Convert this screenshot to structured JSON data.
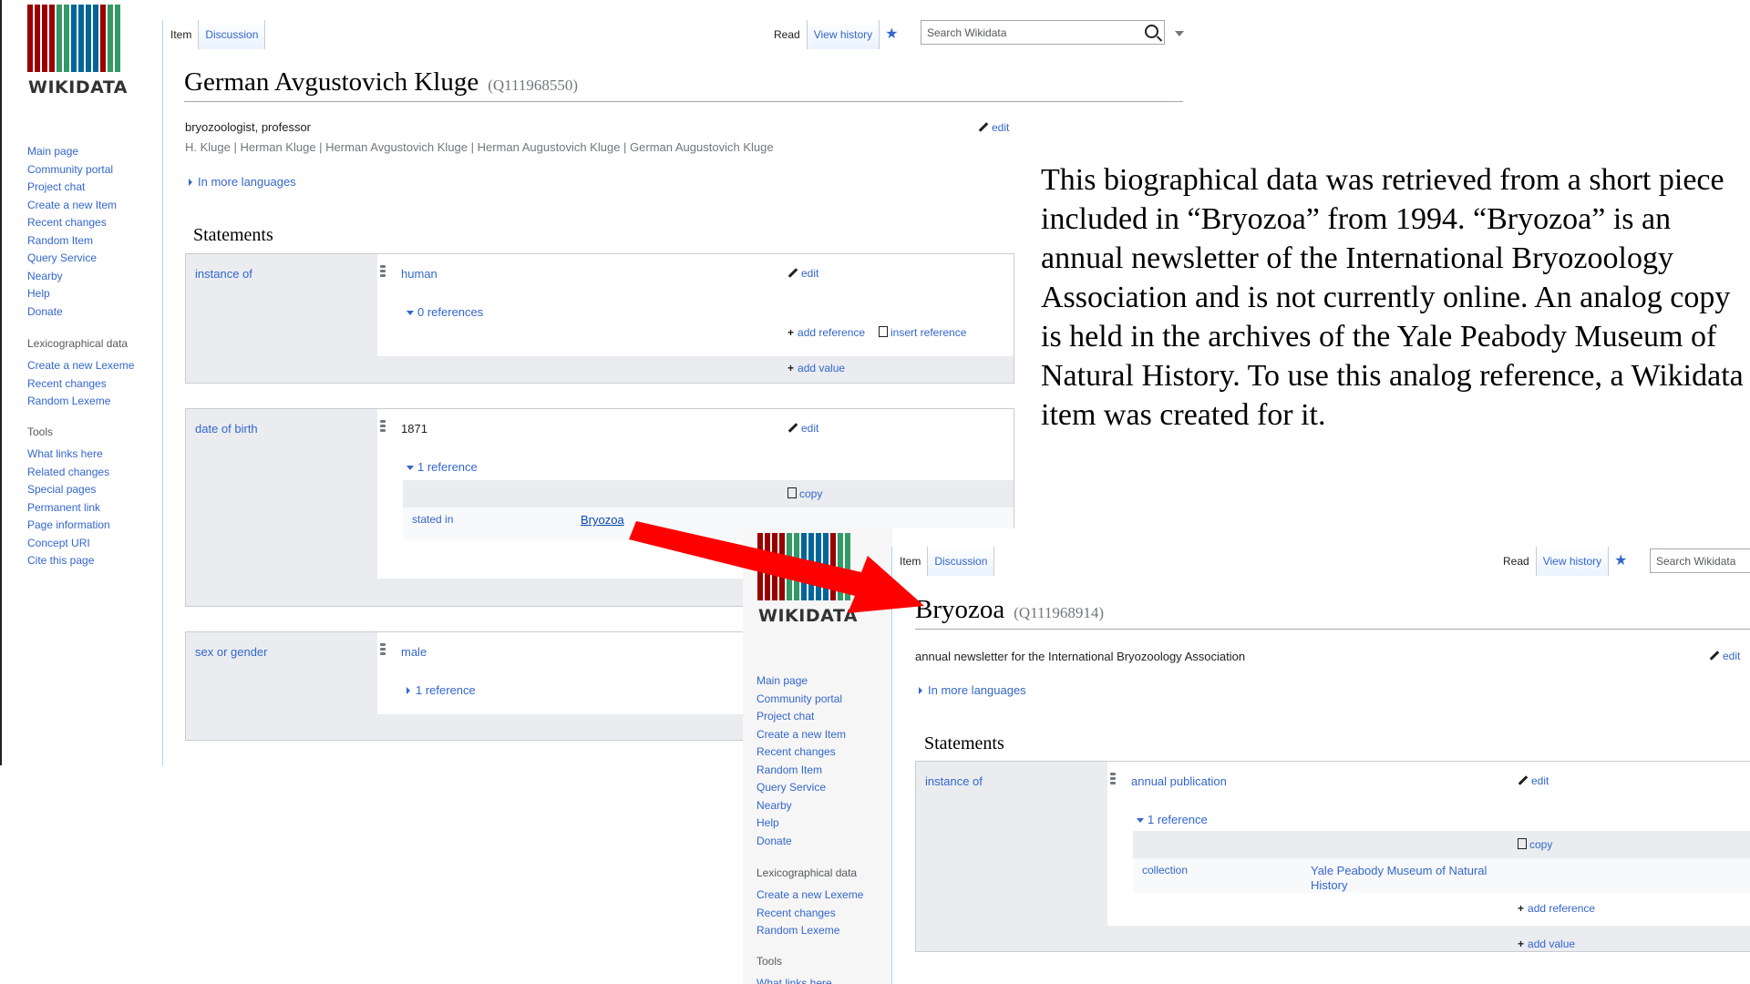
{
  "colors": {
    "accent": "#3366cc",
    "arrow": "#ff0000",
    "logo_red": "#990000",
    "logo_green": "#339966",
    "logo_blue": "#006699"
  },
  "note": "This biographical data was retrieved from a short piece included in “Bryozoa” from 1994. “Bryozoa” is an annual newsletter of the International Bryozoology Association and is not currently online. An analog copy is held in the archives of the Yale Peabody Museum of Natural History. To use this analog reference, a Wikidata item was created for it.",
  "main": {
    "logo_text": "WIKIDATA",
    "tabs": {
      "item": "Item",
      "discussion": "Discussion",
      "read": "Read",
      "history": "View history"
    },
    "search": {
      "placeholder": "Search Wikidata"
    },
    "nav": [
      "Main page",
      "Community portal",
      "Project chat",
      "Create a new Item",
      "Recent changes",
      "Random Item",
      "Query Service",
      "Nearby",
      "Help",
      "Donate"
    ],
    "lex_heading": "Lexicographical data",
    "lex": [
      "Create a new Lexeme",
      "Recent changes",
      "Random Lexeme"
    ],
    "tools_heading": "Tools",
    "tools": [
      "What links here",
      "Related changes",
      "Special pages",
      "Permanent link",
      "Page information",
      "Concept URI",
      "Cite this page"
    ],
    "title": "German Avgustovich Kluge",
    "qid": "(Q111968550)",
    "description": "bryozoologist, professor",
    "aliases": "H. Kluge | Herman Kluge | Herman Avgustovich Kluge | Herman Augustovich Kluge | German Augustovich Kluge",
    "edit": "edit",
    "more_languages": "In more languages",
    "statements_heading": "Statements",
    "statements": [
      {
        "property": "instance of",
        "value": "human",
        "refs": "0 references",
        "add_reference": "add reference",
        "insert_reference": "insert reference",
        "add_value": "add value",
        "edit": "edit"
      },
      {
        "property": "date of birth",
        "value": "1871",
        "refs": "1 reference",
        "copy": "copy",
        "ref_prop": "stated in",
        "ref_value": "Bryozoa",
        "edit": "edit"
      },
      {
        "property": "sex or gender",
        "value": "male",
        "refs": "1 reference"
      }
    ]
  },
  "inset": {
    "logo_text": "WIKIDATA",
    "tabs": {
      "item": "Item",
      "discussion": "Discussion",
      "read": "Read",
      "history": "View history"
    },
    "search": {
      "placeholder": "Search Wikidata"
    },
    "nav": [
      "Main page",
      "Community portal",
      "Project chat",
      "Create a new Item",
      "Recent changes",
      "Random Item",
      "Query Service",
      "Nearby",
      "Help",
      "Donate"
    ],
    "lex_heading": "Lexicographical data",
    "lex": [
      "Create a new Lexeme",
      "Recent changes",
      "Random Lexeme"
    ],
    "tools_heading": "Tools",
    "tools": [
      "What links here"
    ],
    "title": "Bryozoa",
    "qid": "(Q111968914)",
    "description": "annual newsletter for the International Bryozoology Association",
    "edit": "edit",
    "more_languages": "In more languages",
    "statements_heading": "Statements",
    "statement": {
      "property": "instance of",
      "value": "annual publication",
      "refs": "1 reference",
      "copy": "copy",
      "ref_prop": "collection",
      "ref_value": "Yale Peabody Museum of Natural History",
      "add_reference": "add reference",
      "add_value": "add value",
      "edit": "edit"
    }
  }
}
